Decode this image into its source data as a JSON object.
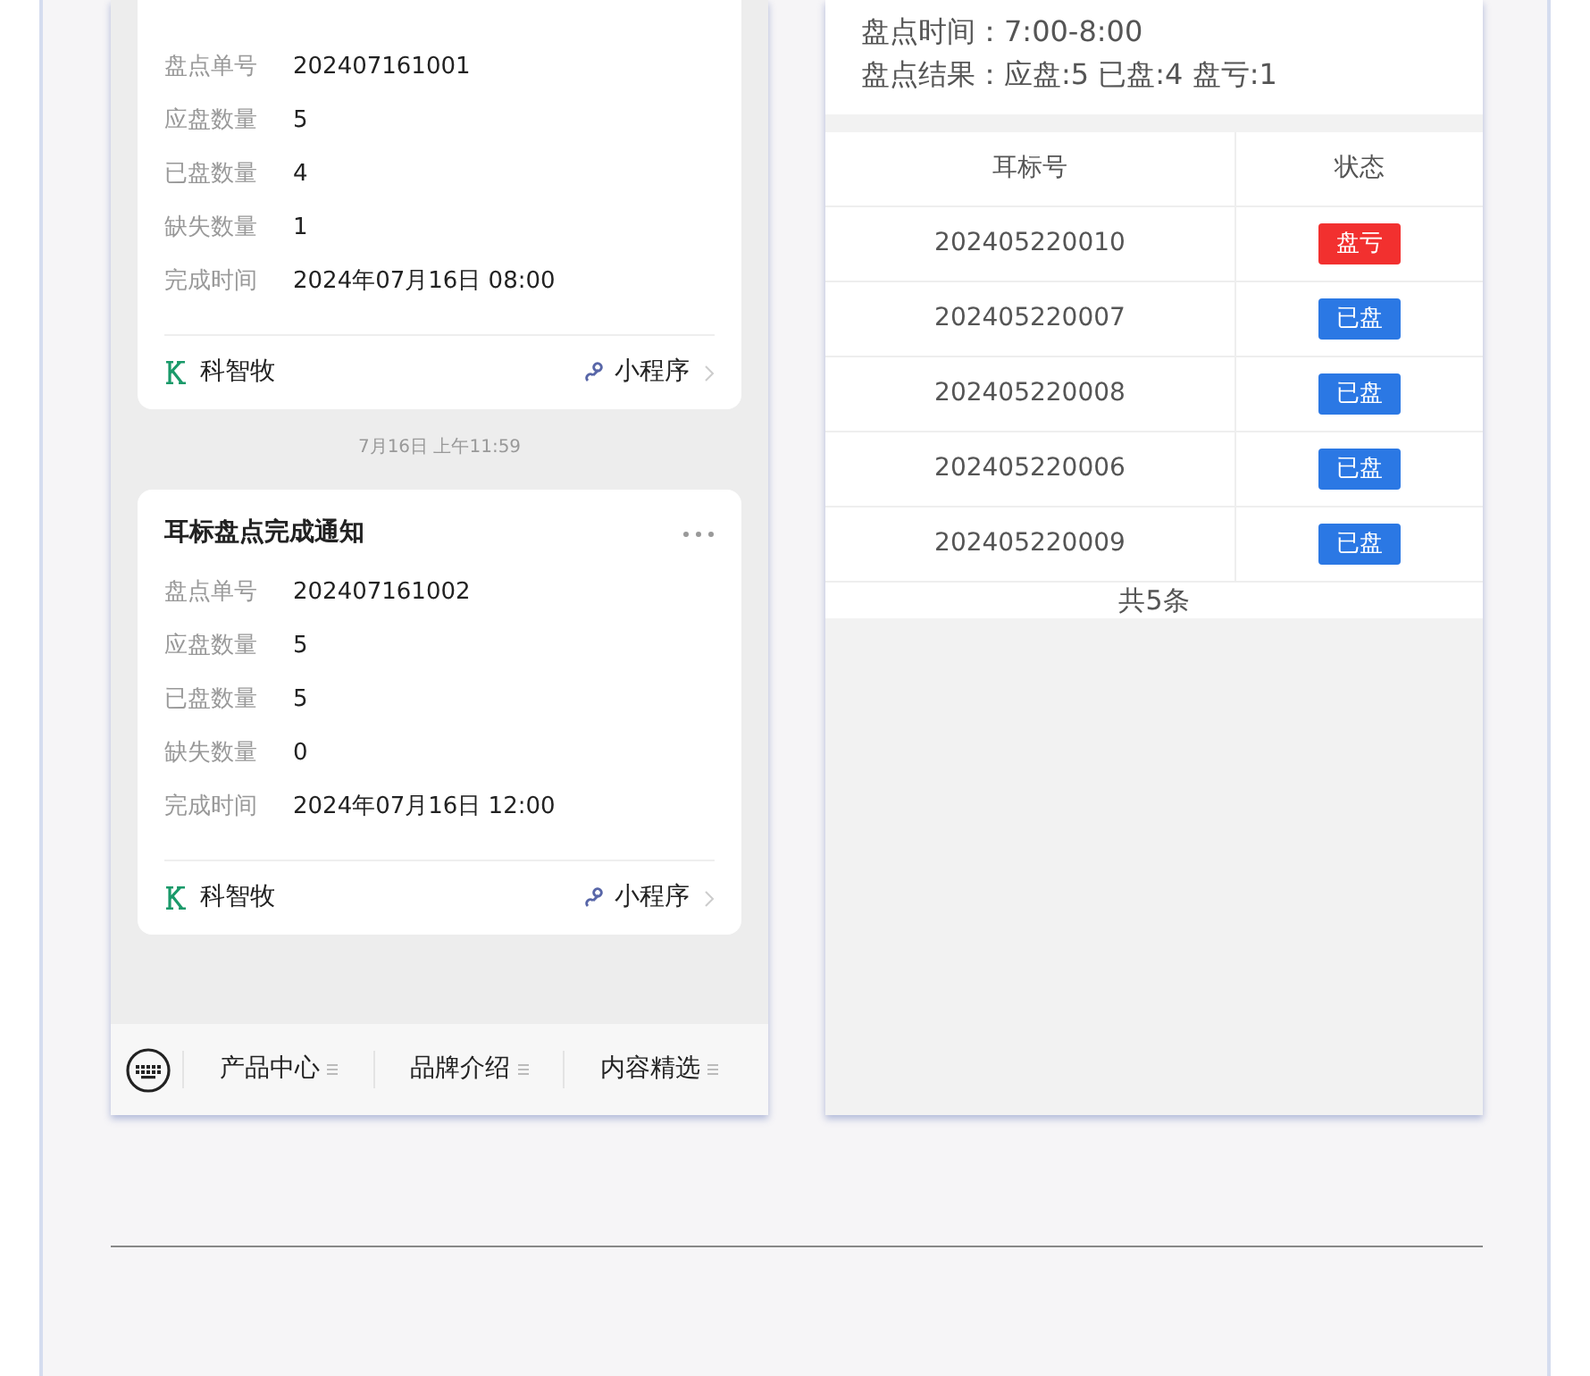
{
  "chat": {
    "items": [
      {
        "kind": "card",
        "fields": [
          {
            "label": "盘点单号",
            "value": "202407161001"
          },
          {
            "label": "应盘数量",
            "value": "5"
          },
          {
            "label": "已盘数量",
            "value": "4"
          },
          {
            "label": "缺失数量",
            "value": "1"
          },
          {
            "label": "完成时间",
            "value": "2024年07月16日 08:00"
          }
        ],
        "brand": "科智牧",
        "link": "小程序"
      },
      {
        "kind": "time",
        "text": "7月16日 上午11:59"
      },
      {
        "kind": "card",
        "title": "耳标盘点完成通知",
        "fields": [
          {
            "label": "盘点单号",
            "value": "202407161002"
          },
          {
            "label": "应盘数量",
            "value": "5"
          },
          {
            "label": "已盘数量",
            "value": "5"
          },
          {
            "label": "缺失数量",
            "value": "0"
          },
          {
            "label": "完成时间",
            "value": "2024年07月16日 12:00"
          }
        ],
        "brand": "科智牧",
        "link": "小程序"
      }
    ],
    "menus": [
      "产品中心",
      "品牌介绍",
      "内容精选"
    ]
  },
  "report": {
    "info": [
      "盘点时间：7:00-8:00",
      "盘点结果：应盘:5 已盘:4 盘亏:1"
    ],
    "table": {
      "columns": [
        "耳标号",
        "状态"
      ],
      "rows": [
        {
          "tag": "202405220010",
          "status": "盘亏",
          "kind": "loss"
        },
        {
          "tag": "202405220007",
          "status": "已盘",
          "kind": "done"
        },
        {
          "tag": "202405220008",
          "status": "已盘",
          "kind": "done"
        },
        {
          "tag": "202405220006",
          "status": "已盘",
          "kind": "done"
        },
        {
          "tag": "202405220009",
          "status": "已盘",
          "kind": "done"
        }
      ]
    },
    "total": "共5条"
  }
}
